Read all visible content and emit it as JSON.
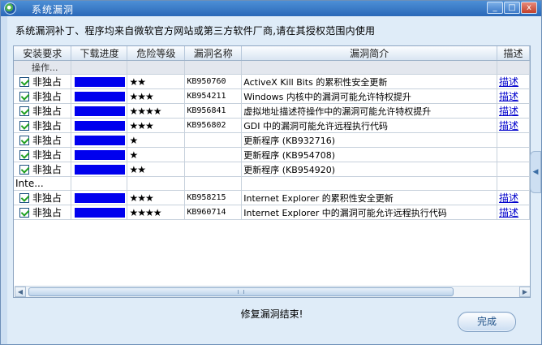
{
  "window": {
    "title": "系统漏洞",
    "buttons": [
      "_",
      "□",
      "x"
    ]
  },
  "subtitle": "系统漏洞补丁、程序均来自微软官方网站或第三方软件厂商,请在其授权范围内使用",
  "table": {
    "headers": [
      "安装要求",
      "下载进度",
      "危险等级",
      "漏洞名称",
      "漏洞简介",
      "描述"
    ],
    "rows": [
      {
        "type": "group",
        "label": "操作..."
      },
      {
        "type": "item",
        "req": "非独占",
        "progress": 1.0,
        "risk": "★★",
        "name": "KB950760",
        "desc": "ActiveX Kill Bits 的累积性安全更新",
        "link": "描述"
      },
      {
        "type": "item",
        "req": "非独占",
        "progress": 1.0,
        "risk": "★★★",
        "name": "KB954211",
        "desc": "Windows 内核中的漏洞可能允许特权提升",
        "link": "描述"
      },
      {
        "type": "item",
        "req": "非独占",
        "progress": 1.0,
        "risk": "★★★★",
        "name": "KB956841",
        "desc": "虚拟地址描述符操作中的漏洞可能允许特权提升",
        "link": "描述"
      },
      {
        "type": "item",
        "req": "非独占",
        "progress": 1.0,
        "risk": "★★★",
        "name": "KB956802",
        "desc": "GDI 中的漏洞可能允许远程执行代码",
        "link": "描述"
      },
      {
        "type": "item",
        "req": "非独占",
        "progress": 1.0,
        "risk": "★",
        "name": "",
        "desc": "更新程序 (KB932716)",
        "link": ""
      },
      {
        "type": "item",
        "req": "非独占",
        "progress": 1.0,
        "risk": "★",
        "name": "",
        "desc": "更新程序 (KB954708)",
        "link": ""
      },
      {
        "type": "item",
        "req": "非独占",
        "progress": 1.0,
        "risk": "★★",
        "name": "",
        "desc": "更新程序 (KB954920)",
        "link": ""
      },
      {
        "type": "blank",
        "label": "Inte..."
      },
      {
        "type": "item",
        "req": "非独占",
        "progress": 1.0,
        "risk": "★★★",
        "name": "KB958215",
        "desc": "Internet Explorer 的累积性安全更新",
        "link": "描述"
      },
      {
        "type": "item",
        "req": "非独占",
        "progress": 1.0,
        "risk": "★★★★",
        "name": "KB960714",
        "desc": "Internet Explorer 中的漏洞可能允许远程执行代码",
        "link": "描述"
      }
    ]
  },
  "status": "修复漏洞结束!",
  "done_button": "完成",
  "colors": {
    "progress": "#0000ee",
    "titlebar": "#2a68b8",
    "link": "#0000cc"
  }
}
